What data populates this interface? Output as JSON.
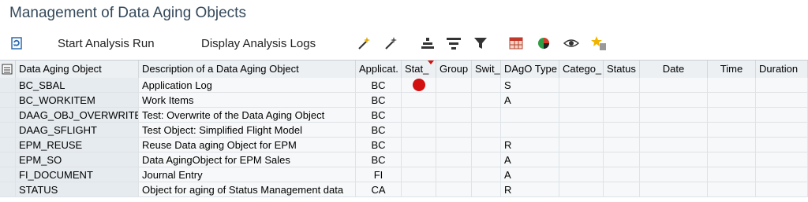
{
  "title": "Management of Data Aging Objects",
  "toolbar": {
    "start_label": "Start Analysis Run",
    "display_label": "Display Analysis Logs",
    "icons": [
      "refresh-icon",
      "wand-icon",
      "wand-select-icon",
      "align-center-icon",
      "filter-list-icon",
      "filter-icon",
      "layout-grid-icon",
      "chart-icon",
      "eye-icon",
      "delete-star-icon"
    ]
  },
  "table": {
    "columns": [
      "Data Aging Object",
      "Description of a Data Aging Object",
      "Applicat.",
      "Stat_",
      "Group",
      "Swit_",
      "DAgO Type",
      "Catego_",
      "Status",
      "Date",
      "Time",
      "Duration"
    ],
    "rows": [
      {
        "object": "BC_SBAL",
        "desc": "Application Log",
        "app": "BC",
        "stat": "red",
        "type": "S"
      },
      {
        "object": "BC_WORKITEM",
        "desc": "Work Items",
        "app": "BC",
        "stat": "",
        "type": "A"
      },
      {
        "object": "DAAG_OBJ_OVERWRITE",
        "desc": "Test: Overwrite of the Data Aging Object",
        "app": "BC",
        "stat": "",
        "type": ""
      },
      {
        "object": "DAAG_SFLIGHT",
        "desc": "Test Object: Simplified Flight Model",
        "app": "BC",
        "stat": "",
        "type": ""
      },
      {
        "object": "EPM_REUSE",
        "desc": "Reuse Data aging Object for EPM",
        "app": "BC",
        "stat": "",
        "type": "R"
      },
      {
        "object": "EPM_SO",
        "desc": "Data AgingObject for EPM Sales",
        "app": "BC",
        "stat": "",
        "type": "A"
      },
      {
        "object": "FI_DOCUMENT",
        "desc": "Journal Entry",
        "app": "FI",
        "stat": "",
        "type": "A"
      },
      {
        "object": "STATUS",
        "desc": "Object for aging of Status Management data",
        "app": "CA",
        "stat": "",
        "type": "R"
      }
    ]
  }
}
